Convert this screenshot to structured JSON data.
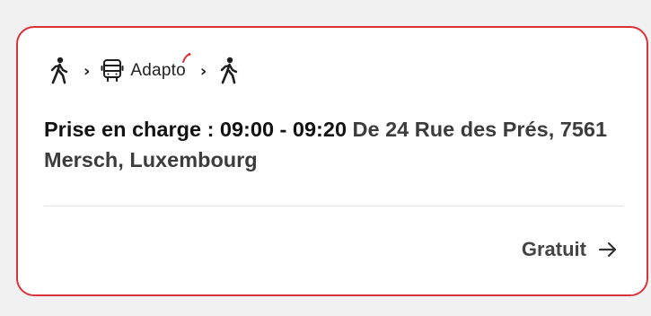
{
  "route": {
    "steps": [
      {
        "icon": "walk-icon"
      },
      {
        "icon": "chevron-right-icon"
      },
      {
        "icon": "bus-icon"
      },
      {
        "icon": "chevron-right-icon"
      },
      {
        "icon": "walk-icon"
      }
    ],
    "chevron_glyph": "›",
    "service_name": "Adapto",
    "service_name_head": "Adapt",
    "service_name_tail": "o"
  },
  "pickup": {
    "label": "Prise en charge : 09:00 - 09:20",
    "address": "De 24 Rue des Prés, 7561 Mersch, Luxembourg"
  },
  "price": {
    "label": "Gratuit",
    "icon": "arrow-right-icon"
  },
  "colors": {
    "border": "#d9323a",
    "accent": "#d9323a",
    "text": "#1a1a1a",
    "muted": "#444444",
    "background": "#f1f1f2"
  }
}
